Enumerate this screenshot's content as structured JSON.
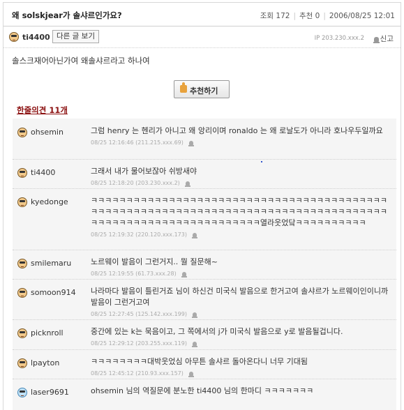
{
  "post": {
    "title": "왜 solskjear가 솔샤르인가요?",
    "views_label": "조회 172",
    "recs_label": "추천 0",
    "date": "2006/08/25 12:01",
    "author": "ti4400",
    "other_posts_label": "다른 글 보기",
    "ip": "IP 203.230.xxx.2",
    "report_label": "신고",
    "body": "솔스크재어아닌가여 왜솔샤르라고 하나여",
    "recommend_label": "추천하기"
  },
  "comments_header": "한줄의견 11개",
  "comments": [
    {
      "user": "ohsemin",
      "text": "그럼 henry 는 헨리가 아니고 왜 앙리이며 ronaldo 는 왜 로날도가 아니라 호나우두일까요",
      "meta": "08/25 12:16:46 (211.215.xxx.69)"
    },
    {
      "user": "ti4400",
      "text": "그래서 내가 물어보잖아 쉬방새야",
      "meta": "08/25 12:18:20 (203.230.xxx.2)"
    },
    {
      "user": "kyedonge",
      "text": "ㅋㅋㅋㅋㅋㅋㅋㅋㅋㅋㅋㅋㅋㅋㅋㅋㅋㅋㅋㅋㅋㅋㅋㅋㅋㅋㅋㅋㅋㅋㅋㅋㅋㅋㅋㅋㅋㅋㅋㅋㅋㅋㅋㅋㅋㅋㅋㅋㅋㅋㅋㅋㅋㅋㅋㅋㅋㅋㅋㅋㅋㅋㅋㅋㅋㅋㅋㅋㅋㅋㅋㅋㅋㅋㅋㅋㅋㅋㅋㅋㅋㅋㅋㅋㅋㅋㅋㅋㅋㅋㅋㅋㅋㅋㅋㅋㅋㅋㅋㅋㅋㅋㅋㅋㅋㅋㅋㅋ열라웃었닼ㅋㅋㅋㅋㅋㅋㅋㅋㅋㅋ",
      "meta": "08/25 12:19:32 (220.120.xxx.173)"
    },
    {
      "user": "smilemaru",
      "text": "노르웨이 발음이 그런거지.. 뭘 질문해~",
      "meta": "08/25 12:19:55 (61.73.xxx.28)"
    },
    {
      "user": "somoon914",
      "text": "나라마다 발음이 틀린거죠 님이 하신건 미국식 발음으로 한거고여 솔샤르가 노르웨이인이니까 발음이 그런거고여",
      "meta": "08/25 12:27:45 (125.142.xxx.199)"
    },
    {
      "user": "picknroll",
      "text": "중간에 있는 k는 묵음이고, 그 쪽에서의 j가 미국식 발음으로 y로 발음될겁니다.",
      "meta": "08/25 12:29:12 (203.255.xxx.119)"
    },
    {
      "user": "lpayton",
      "text": "ㅋㅋㅋㅋㅋㅋㅋㅋ대박웃었심 아무튼 솔샤르 돌아온다니 너무 기대됨",
      "meta": "08/25 12:45:12 (210.93.xxx.157)"
    },
    {
      "user": "laser9691",
      "text": "ohsemin 님의 역질문에 분노한 ti4400 님의 한마디 ㅋㅋㅋㅋㅋㅋㅋ",
      "meta": ""
    }
  ]
}
